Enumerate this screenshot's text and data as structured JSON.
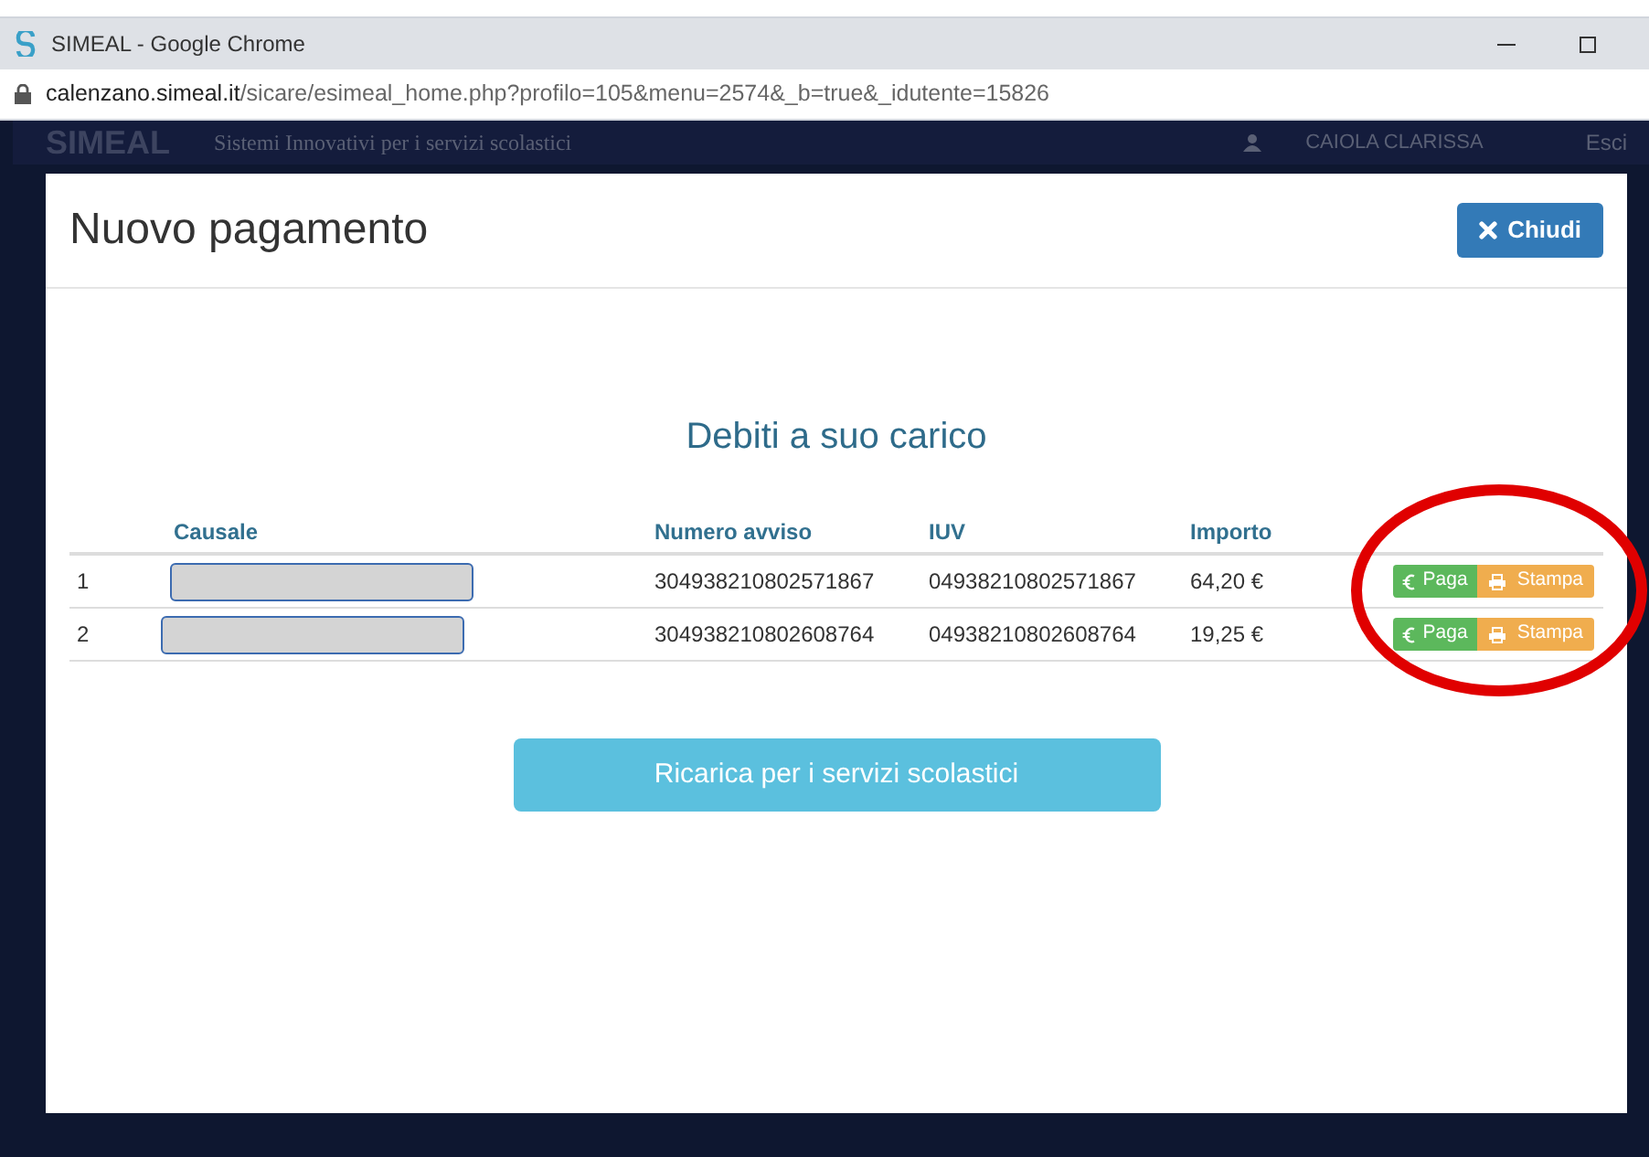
{
  "browser": {
    "title": "SIMEAL - Google Chrome",
    "url_host": "calenzano.simeal.it",
    "url_path": "/sicare/esimeal_home.php?profilo=105&menu=2574&_b=true&_idutente=15826"
  },
  "site_header": {
    "logo": "SIMEAL",
    "tagline": "Sistemi Innovativi per i servizi scolastici",
    "user": "CAIOLA CLARISSA",
    "logout": "Esci"
  },
  "modal": {
    "title": "Nuovo pagamento",
    "close_button": "Chiudi",
    "heading": "Debiti a suo carico",
    "table": {
      "columns": [
        "",
        "Causale",
        "Numero avviso",
        "IUV",
        "Importo",
        ""
      ],
      "rows": [
        {
          "index": "1",
          "numero_avviso": "304938210802571867",
          "iuv": "04938210802571867",
          "importo": "64,20 €",
          "pay": "Paga",
          "print": "Stampa"
        },
        {
          "index": "2",
          "numero_avviso": "304938210802608764",
          "iuv": "04938210802608764",
          "importo": "19,25 €",
          "pay": "Paga",
          "print": "Stampa"
        }
      ]
    },
    "recharge_button": "Ricarica per i servizi scolastici"
  }
}
